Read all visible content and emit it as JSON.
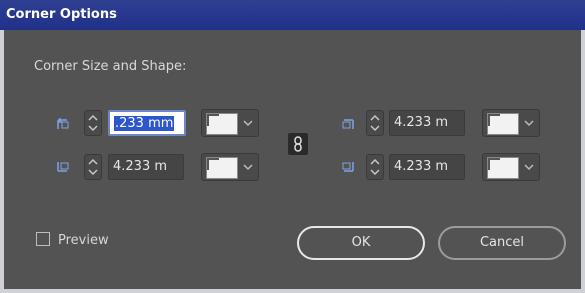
{
  "window": {
    "title": "Corner Options"
  },
  "section": {
    "label": "Corner Size and Shape:"
  },
  "corners": {
    "top_left": {
      "value_prefix": ".233 mm",
      "icon": "top-left-corner-icon"
    },
    "top_right": {
      "value": "4.233 m",
      "icon": "top-right-corner-icon"
    },
    "bottom_left": {
      "value": "4.233 m",
      "icon": "bottom-left-corner-icon"
    },
    "bottom_right": {
      "value": "4.233 m",
      "icon": "bottom-right-corner-icon"
    }
  },
  "link": {
    "icon": "chain-link-icon"
  },
  "preview": {
    "label": "Preview",
    "checked": false
  },
  "buttons": {
    "ok": "OK",
    "cancel": "Cancel"
  },
  "colors": {
    "titlebar": "#21308a",
    "dialog_bg": "#535353",
    "selection": "#2c56c9"
  }
}
